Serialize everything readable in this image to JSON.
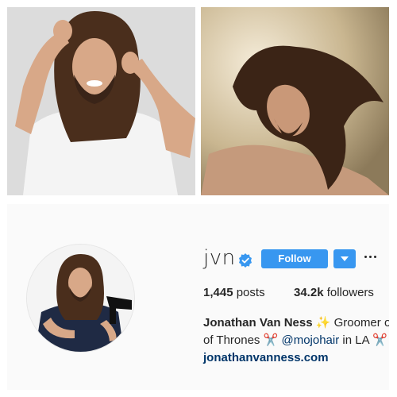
{
  "profile": {
    "username": "jvn",
    "follow_label": "Follow",
    "posts_count": "1,445",
    "posts_label": "posts",
    "followers_count": "34.2k",
    "followers_label": "followers",
    "full_name": "Jonathan Van Ness",
    "bio_sparkle": "✨",
    "bio_text_1": "Groomer on",
    "bio_text_2a": "of Thrones",
    "bio_scissors": "✂️",
    "bio_mention_1": "@mojohair",
    "bio_text_2b": "in LA",
    "bio_mention_2_start": "@",
    "website": "jonathanvanness.com"
  },
  "colors": {
    "follow_blue": "#3897f0",
    "verified_blue": "#3897f0",
    "link_blue": "#003569",
    "panel_bg": "#fafafa"
  },
  "icons": {
    "verified": "verified-badge-icon",
    "dropdown": "chevron-down-icon",
    "more": "more-options-icon"
  }
}
